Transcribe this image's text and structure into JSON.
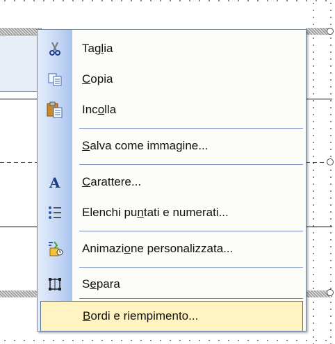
{
  "menu": {
    "items": [
      {
        "label_pre": "Tag",
        "label_u": "l",
        "label_post": "ia",
        "icon": "scissors-icon"
      },
      {
        "label_pre": "",
        "label_u": "C",
        "label_post": "opia",
        "icon": "copy-icon"
      },
      {
        "label_pre": "Inc",
        "label_u": "o",
        "label_post": "lla",
        "icon": "paste-icon"
      },
      {
        "label_pre": "",
        "label_u": "S",
        "label_post": "alva come immagine...",
        "icon": null
      },
      {
        "label_pre": "",
        "label_u": "C",
        "label_post": "arattere...",
        "icon": "font-icon"
      },
      {
        "label_pre": "Elenchi pu",
        "label_u": "n",
        "label_post": "tati e numerati...",
        "icon": "bullets-icon"
      },
      {
        "label_pre": "Animazi",
        "label_u": "o",
        "label_post": "ne personalizzata...",
        "icon": "animation-icon"
      },
      {
        "label_pre": "S",
        "label_u": "e",
        "label_post": "para",
        "icon": "ungroup-icon"
      },
      {
        "label_pre": "",
        "label_u": "B",
        "label_post": "ordi e riempimento...",
        "icon": null
      }
    ],
    "highlight_color": "#fff3c2",
    "separator_color": "#6b86b8"
  }
}
